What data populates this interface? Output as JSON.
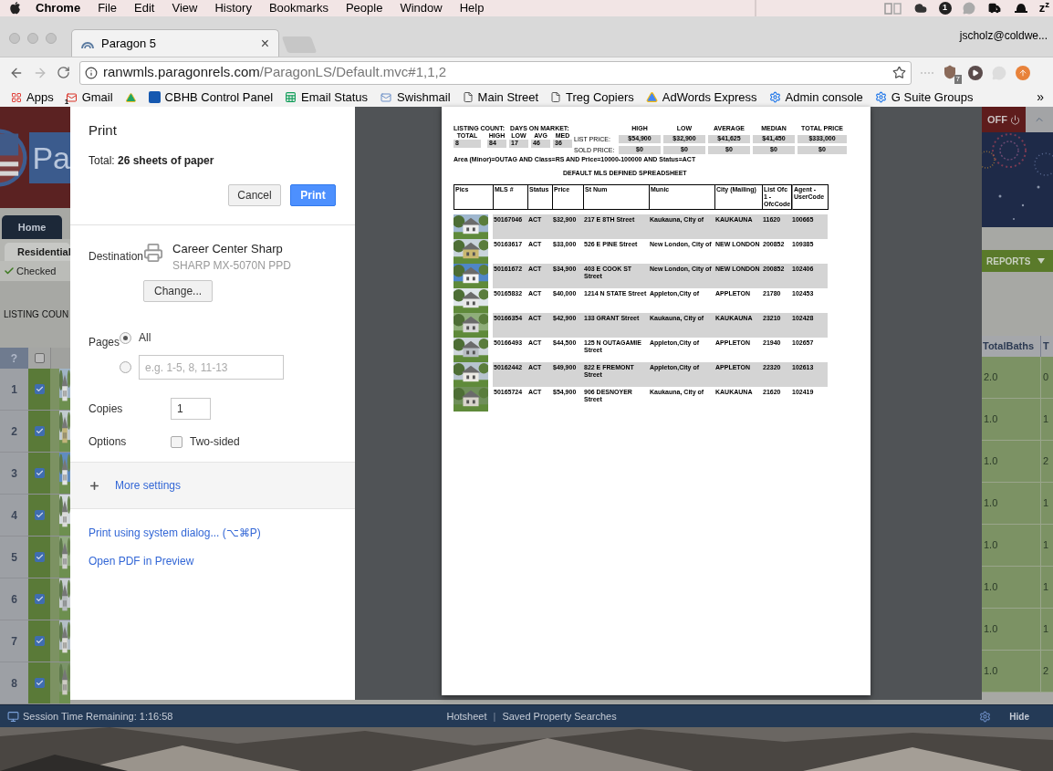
{
  "menu_bar": {
    "app": "Chrome",
    "items": [
      "File",
      "Edit",
      "View",
      "History",
      "Bookmarks",
      "People",
      "Window",
      "Help"
    ],
    "badge": "1",
    "sleep": "z$^{z}$"
  },
  "browser": {
    "tab_title": "Paragon 5",
    "tab_close": "×",
    "profile": "jscholz@coldwe...",
    "url_host": "ranwmls.paragonrels.com",
    "url_path": "/ParagonLS/Default.mvc#1,1,2",
    "extension_badge": "7",
    "bookmarks": [
      {
        "kind": "link",
        "label": "Apps"
      },
      {
        "kind": "link",
        "label": "Gmail",
        "badge": "1"
      },
      {
        "kind": "icon_only"
      },
      {
        "kind": "link",
        "label": "CBHB Control Panel"
      },
      {
        "kind": "link",
        "label": "Email Status"
      },
      {
        "kind": "link",
        "label": "Swishmail"
      },
      {
        "kind": "link",
        "label": "Main Street"
      },
      {
        "kind": "link",
        "label": "Treg Copiers"
      },
      {
        "kind": "link",
        "label": "AdWords Express"
      },
      {
        "kind": "link",
        "label": "Admin console"
      },
      {
        "kind": "link",
        "label": "G Suite Groups"
      }
    ],
    "overflow": "»"
  },
  "background_app": {
    "logo_text": "Pa",
    "home_tab": "Home",
    "residential_tab": "Residential",
    "checked_label": "Checked",
    "listing_count": "LISTING COUN",
    "off_button": "OFF",
    "reports_button": "REPORTS",
    "help": "?",
    "select_all_checked": false,
    "columns": [
      "TotalBaths",
      "T"
    ],
    "rows": [
      {
        "number": "1",
        "checked": true,
        "baths": "2.0",
        "column_t": "0"
      },
      {
        "number": "2",
        "checked": true,
        "baths": "1.0",
        "column_t": "1"
      },
      {
        "number": "3",
        "checked": true,
        "baths": "1.0",
        "column_t": "2"
      },
      {
        "number": "4",
        "checked": true,
        "baths": "1.0",
        "column_t": "1"
      },
      {
        "number": "5",
        "checked": true,
        "baths": "1.0",
        "column_t": "1"
      },
      {
        "number": "6",
        "checked": true,
        "baths": "1.0",
        "column_t": "1"
      },
      {
        "number": "7",
        "checked": true,
        "baths": "1.0",
        "column_t": "1"
      },
      {
        "number": "8",
        "checked": true,
        "baths": "1.0",
        "column_t": "2"
      }
    ]
  },
  "print_dialog": {
    "title": "Print",
    "total": "Total: **26 sheets of paper**",
    "cancel": "Cancel",
    "print": "Print",
    "destination_label": "Destination",
    "printer_name": "Career Center Sharp",
    "printer_model": "SHARP MX-5070N PPD",
    "change": "Change...",
    "pages_label": "Pages",
    "pages": [
      {
        "kind": "radio",
        "label": "All",
        "selected": true
      },
      {
        "kind": "range",
        "placeholder": "e.g. 1-5, 8, 11-13",
        "selected": false
      }
    ],
    "copies_label": "Copies",
    "copies": "1",
    "options_label": "Options",
    "two_sided": {
      "label": "Two-sided",
      "checked": false
    },
    "more_settings": "More settings",
    "system_dialog": "Print using system dialog... (⌥⌘P)",
    "open_pdf": "Open PDF in Preview"
  },
  "preview": {
    "listing_count_label": "LISTING COUNT:",
    "days_label": "DAYS ON MARKET:",
    "stats": [
      {
        "label": "TOTAL",
        "value": "8"
      },
      {
        "label": "HIGH",
        "value": "84"
      },
      {
        "label": "LOW",
        "value": "17"
      },
      {
        "label": "AVG",
        "value": "46"
      },
      {
        "label": "MED",
        "value": "36"
      }
    ],
    "price_columns": [
      "HIGH",
      "LOW",
      "AVERAGE",
      "MEDIAN",
      "TOTAL PRICE"
    ],
    "price_rows": [
      {
        "label": "LIST PRICE:",
        "values": [
          "$54,900",
          "$32,900",
          "$41,625",
          "$41,450",
          "$333,000"
        ]
      },
      {
        "label": "SOLD PRICE:",
        "values": [
          "$0",
          "$0",
          "$0",
          "$0",
          "$0"
        ]
      }
    ],
    "criteria": "Area (Minor)=OUTAG AND Class=RS AND Price=10000-100000 AND Status=ACT",
    "title": "DEFAULT MLS DEFINED SPREADSHEET",
    "columns": [
      "Pics",
      "MLS #",
      "Status",
      "Price",
      "St Num",
      "Munic",
      "City (Mailing)",
      "List Ofc 1 - OfcCode",
      "Agent - UserCode"
    ],
    "rows": [
      {
        "mls": "50167046",
        "status": "ACT",
        "price": "$32,900",
        "street": "217 E 8TH Street",
        "munic": "Kaukauna, City of",
        "city": "KAUKAUNA",
        "office": "11620",
        "agent": "100665"
      },
      {
        "mls": "50163617",
        "status": "ACT",
        "price": "$33,000",
        "street": "526 E PINE Street",
        "munic": "New London, City of",
        "city": "NEW LONDON",
        "office": "200852",
        "agent": "109385"
      },
      {
        "mls": "50161672",
        "status": "ACT",
        "price": "$34,900",
        "street": "403 E COOK ST Street",
        "munic": "New London, City of",
        "city": "NEW LONDON",
        "office": "200852",
        "agent": "102406"
      },
      {
        "mls": "50165832",
        "status": "ACT",
        "price": "$40,000",
        "street": "1214 N STATE Street",
        "munic": "Appleton,City of",
        "city": "APPLETON",
        "office": "21780",
        "agent": "102453"
      },
      {
        "mls": "50166354",
        "status": "ACT",
        "price": "$42,900",
        "street": "133 GRANT Street",
        "munic": "Kaukauna, City of",
        "city": "KAUKAUNA",
        "office": "23210",
        "agent": "102428"
      },
      {
        "mls": "50166493",
        "status": "ACT",
        "price": "$44,500",
        "street": "125 N OUTAGAMIE Street",
        "munic": "Appleton,City of",
        "city": "APPLETON",
        "office": "21940",
        "agent": "102657"
      },
      {
        "mls": "50162442",
        "status": "ACT",
        "price": "$49,900",
        "street": "822 E FREMONT Street",
        "munic": "Appleton,City of",
        "city": "APPLETON",
        "office": "22320",
        "agent": "102613"
      },
      {
        "mls": "50165724",
        "status": "ACT",
        "price": "$54,900",
        "street": "906 DESNOYER Street",
        "munic": "Kaukauna, City of",
        "city": "KAUKAUNA",
        "office": "21620",
        "agent": "102419"
      }
    ]
  },
  "status_bar": {
    "session": "Session Time Remaining: 1:16:58",
    "links": [
      "Hotsheet",
      "Saved Property Searches"
    ],
    "separator": "|",
    "hide": "Hide"
  }
}
